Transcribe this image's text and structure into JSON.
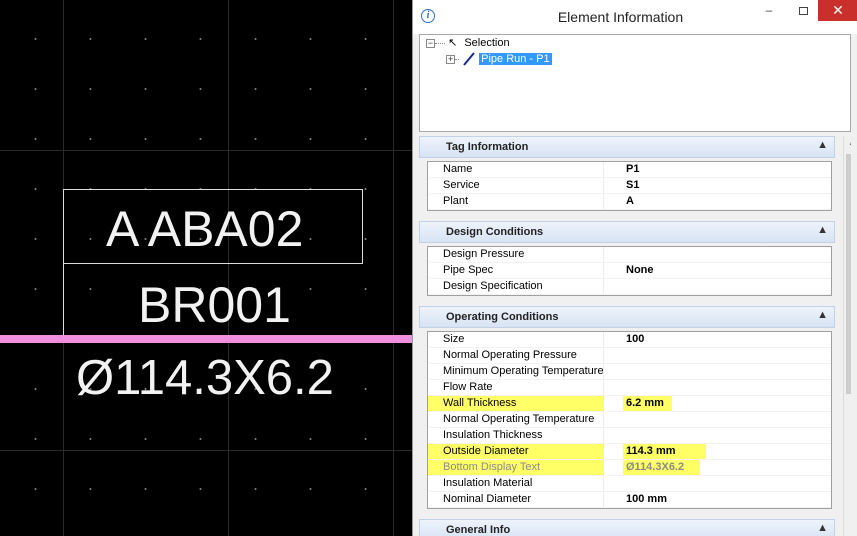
{
  "cad": {
    "line1": "A ABA02",
    "line2": "BR001",
    "line3": "Ø114.3X6.2",
    "pipe_color": "#f08ee0"
  },
  "window": {
    "title": "Element Information",
    "info_icon": "info-icon",
    "close_glyph": "✕",
    "min_glyph": "–"
  },
  "tree": {
    "root_label": "Selection",
    "child_label": "Pipe Run - P1",
    "root_expander": "−",
    "child_expander": "+"
  },
  "sections": {
    "tag": {
      "title": "Tag Information",
      "rows": [
        {
          "k": "Name",
          "v": "P1"
        },
        {
          "k": "Service",
          "v": "S1"
        },
        {
          "k": "Plant",
          "v": "A"
        }
      ]
    },
    "design": {
      "title": "Design Conditions",
      "rows": [
        {
          "k": "Design Pressure",
          "v": ""
        },
        {
          "k": "Pipe Spec",
          "v": "None"
        },
        {
          "k": "Design Specification",
          "v": ""
        }
      ]
    },
    "operating": {
      "title": "Operating Conditions",
      "rows": [
        {
          "k": "Size",
          "v": "100"
        },
        {
          "k": "Normal Operating Pressure",
          "v": ""
        },
        {
          "k": "Minimum Operating Temperature",
          "v": ""
        },
        {
          "k": "Flow Rate",
          "v": ""
        },
        {
          "k": "Wall Thickness",
          "v": "6.2 mm"
        },
        {
          "k": "Normal Operating Temperature",
          "v": ""
        },
        {
          "k": "Insulation Thickness",
          "v": ""
        },
        {
          "k": "Outside Diameter",
          "v": "114.3 mm"
        },
        {
          "k": "Bottom Display Text",
          "v": "Ø114.3X6.2"
        },
        {
          "k": "Insulation Material",
          "v": ""
        },
        {
          "k": "Nominal Diameter",
          "v": "100 mm"
        }
      ]
    },
    "general": {
      "title": "General Info"
    }
  },
  "highlight_color": "#ffff66"
}
